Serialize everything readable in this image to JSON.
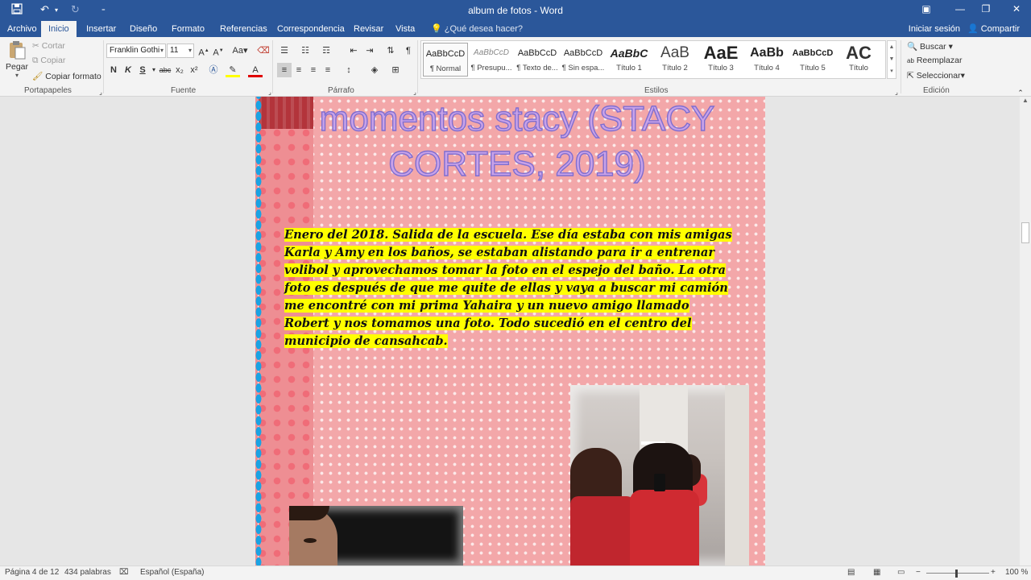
{
  "window": {
    "title": "album de fotos - Word"
  },
  "quick_access": {
    "save_icon": "save-icon",
    "undo_icon": "undo-icon",
    "redo_icon": "redo-icon",
    "customize_icon": "customize-icon"
  },
  "window_controls": {
    "ribbon_display_icon": "ribbon-display-icon",
    "minimize": "—",
    "restore": "❐",
    "close": "✕"
  },
  "tabs": [
    {
      "label": "Archivo"
    },
    {
      "label": "Inicio"
    },
    {
      "label": "Insertar"
    },
    {
      "label": "Diseño"
    },
    {
      "label": "Formato"
    },
    {
      "label": "Referencias"
    },
    {
      "label": "Correspondencia"
    },
    {
      "label": "Revisar"
    },
    {
      "label": "Vista"
    }
  ],
  "tell_me": "¿Qué desea hacer?",
  "account": {
    "signin": "Iniciar sesión",
    "share": "Compartir"
  },
  "clipboard": {
    "paste": "Pegar",
    "cut": "Cortar",
    "copy": "Copiar",
    "format_painter": "Copiar formato",
    "group": "Portapapeles"
  },
  "font": {
    "name": "Franklin Gothi",
    "size": "11",
    "group": "Fuente",
    "aa": "Aa",
    "bold": "N",
    "italic": "K",
    "underline": "S",
    "strike": "abc",
    "sub": "x₂",
    "sup": "x²"
  },
  "paragraph": {
    "group": "Párrafo",
    "pilcrow": "¶"
  },
  "styles": {
    "group": "Estilos",
    "items": [
      {
        "preview": "AaBbCcD",
        "name": "¶ Normal"
      },
      {
        "preview": "AaBbCcD",
        "name": "¶ Presupu..."
      },
      {
        "preview": "AaBbCcD",
        "name": "¶ Texto de..."
      },
      {
        "preview": "AaBbCcD",
        "name": "¶ Sin espa..."
      },
      {
        "preview": "AaBbC",
        "name": "Título 1"
      },
      {
        "preview": "AaB",
        "name": "Título 2"
      },
      {
        "preview": "AaE",
        "name": "Título 3"
      },
      {
        "preview": "AaBb",
        "name": "Título 4"
      },
      {
        "preview": "AaBbCcD",
        "name": "Título 5"
      },
      {
        "preview": "AC",
        "name": "Título"
      }
    ]
  },
  "editing": {
    "group": "Edición",
    "find": "Buscar",
    "replace": "Reemplazar",
    "select": "Seleccionar"
  },
  "document": {
    "title": "momentos stacy (STACY CORTES, 2019)",
    "body": "Enero del 2018. Salida de la escuela. Ese día estaba con mis amigas Karla y Amy en los baños, se estaban alistando para ir a entrenar volibol y aprovechamos tomar la foto en el espejo del baño. La otra foto es después de que me quite de ellas y vaya a buscar mi camión me encontré con mi prima Yahaira y un nuevo amigo llamado Robert y nos tomamos una foto. Todo sucedió en el centro del municipio de cansahcab."
  },
  "status": {
    "page": "Página 4 de 12",
    "words": "434 palabras",
    "language": "Español (España)",
    "zoom": "100 %",
    "zoom_minus": "−",
    "zoom_plus": "+"
  },
  "colors": {
    "accent": "#2b579a",
    "page_pink": "#f3a7a9",
    "highlight": "#ffff00",
    "title_fill": "#c9a2e8",
    "title_outline": "#7f6ed0"
  }
}
